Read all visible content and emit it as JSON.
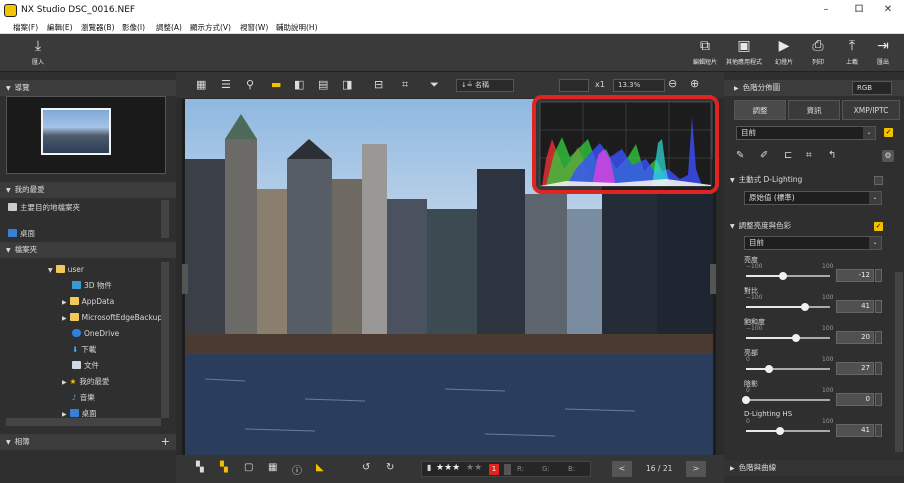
{
  "window": {
    "title": "NX Studio   DSC_0016.NEF",
    "minimize": "–",
    "maximize": "ロ",
    "close": "✕"
  },
  "menu": [
    "檔案(F)",
    "編輯(E)",
    "瀏覽器(B)",
    "影像(I)",
    "調整(A)",
    "顯示方式(V)",
    "視窗(W)",
    "輔助說明(H)"
  ],
  "toolbar": {
    "import_label": "匯入",
    "right_buttons": [
      {
        "icon": "edit-movie-icon",
        "label": "編輯短片"
      },
      {
        "icon": "other-apps-icon",
        "label": "其他應用程式"
      },
      {
        "icon": "slideshow-icon",
        "label": "幻燈片"
      },
      {
        "icon": "print-icon",
        "label": "列印"
      },
      {
        "icon": "upload-icon",
        "label": "上載"
      },
      {
        "icon": "export-icon",
        "label": "匯出"
      }
    ]
  },
  "left_panel": {
    "preview_header": "導覽",
    "favorites_header": "我的最愛",
    "favorites": [
      "主要目的地檔案夾",
      "桌面"
    ],
    "folders_header": "檔案夾",
    "folders": [
      {
        "label": "user",
        "level": 0,
        "expanded": true
      },
      {
        "label": "3D 物件",
        "level": 1
      },
      {
        "label": "AppData",
        "level": 1
      },
      {
        "label": "MicrosoftEdgeBackup",
        "level": 1
      },
      {
        "label": "OneDrive",
        "level": 1
      },
      {
        "label": "下載",
        "level": 1
      },
      {
        "label": "文件",
        "level": 1
      },
      {
        "label": "我的最愛",
        "level": 1
      },
      {
        "label": "音樂",
        "level": 1
      },
      {
        "label": "桌面",
        "level": 1
      }
    ],
    "album_header": "相簿",
    "album_add": "+"
  },
  "view_toolbar": {
    "sort_label": "↓≟ 名稱",
    "zoom_x": "x1",
    "zoom_percent": "13.3%",
    "zoom_out": "⊖",
    "zoom_in": "⊕"
  },
  "bottom_bar": {
    "rating_stars": "★★★",
    "rating_empty": "★★",
    "label_badge": "1",
    "r_label": "R:",
    "g_label": "G:",
    "b_label": "B:",
    "page": "16 / 21"
  },
  "right_panel": {
    "histogram_header": "色階分佈圖",
    "histogram_mode": "RGB",
    "tabs": [
      "調整",
      "資訊",
      "XMP/IPTC"
    ],
    "active_tab": 0,
    "preset": "目前",
    "d_lighting_header": "主動式 D-Lighting",
    "d_lighting_value": "原始值 (標準)",
    "brightness_header": "調整亮度與色彩",
    "brightness_preset": "目前",
    "sliders": [
      {
        "label": "亮度",
        "min": "−100",
        "max": "100",
        "value": "-12",
        "fraction": 0.44
      },
      {
        "label": "對比",
        "min": "−100",
        "max": "100",
        "value": "41",
        "fraction": 0.7
      },
      {
        "label": "飽和度",
        "min": "−100",
        "max": "100",
        "value": "20",
        "fraction": 0.6
      },
      {
        "label": "亮部",
        "min": "0",
        "max": "100",
        "value": "27",
        "fraction": 0.27
      },
      {
        "label": "陰影",
        "min": "0",
        "max": "100",
        "value": "0",
        "fraction": 0.0
      },
      {
        "label": "D-Lighting HS",
        "min": "0",
        "max": "100",
        "value": "41",
        "fraction": 0.41
      }
    ],
    "tone_curve_header": "色階與曲線"
  },
  "colors": {
    "accent": "#f2c200",
    "highlight_box": "#e0241f"
  }
}
